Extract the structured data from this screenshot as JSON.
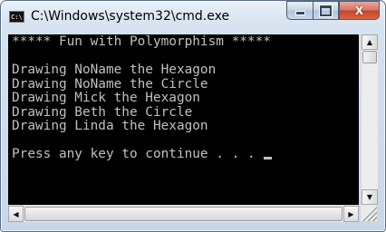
{
  "window": {
    "title": "C:\\Windows\\system32\\cmd.exe",
    "app_icon_text": "C:\\"
  },
  "caption_buttons": {
    "minimize": "minimize",
    "maximize": "maximize",
    "close": "X"
  },
  "console": {
    "lines": [
      "***** Fun with Polymorphism *****",
      "",
      "Drawing NoName the Hexagon",
      "Drawing NoName the Circle",
      "Drawing Mick the Hexagon",
      "Drawing Beth the Circle",
      "Drawing Linda the Hexagon",
      "",
      "Press any key to continue . . . "
    ],
    "text_color": "#c0c0c0",
    "background_color": "#000000"
  },
  "scrollbars": {
    "up_arrow": "▲",
    "down_arrow": "▼",
    "left_arrow": "◀",
    "right_arrow": "▶"
  }
}
